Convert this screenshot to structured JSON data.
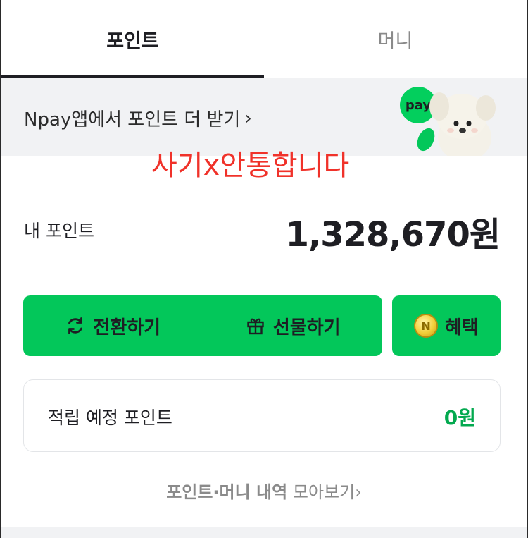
{
  "tabs": [
    {
      "label": "포인트",
      "active": true
    },
    {
      "label": "머니",
      "active": false
    }
  ],
  "banner": {
    "text": "Npay앱에서 포인트 더 받기",
    "chevron": "›",
    "pay_badge": "pay"
  },
  "overlay_text": "사기x안통합니다",
  "points": {
    "label": "내 포인트",
    "value": "1,328,670원"
  },
  "actions": {
    "convert_label": "전환하기",
    "gift_label": "선물하기",
    "benefit_label": "혜택",
    "benefit_coin": "N"
  },
  "expected": {
    "label": "적립 예정 포인트",
    "value": "0원"
  },
  "history": {
    "bold_label": "포인트·머니 내역",
    "label": "모아보기",
    "chevron": "›"
  },
  "colors": {
    "brand_green": "#03c75a",
    "accent_green_text": "#03a94f",
    "overlay_red": "#f0322a"
  },
  "icons": [
    "refresh-icon",
    "gift-icon",
    "n-coin-icon",
    "chevron-right-icon",
    "mascot-image"
  ]
}
